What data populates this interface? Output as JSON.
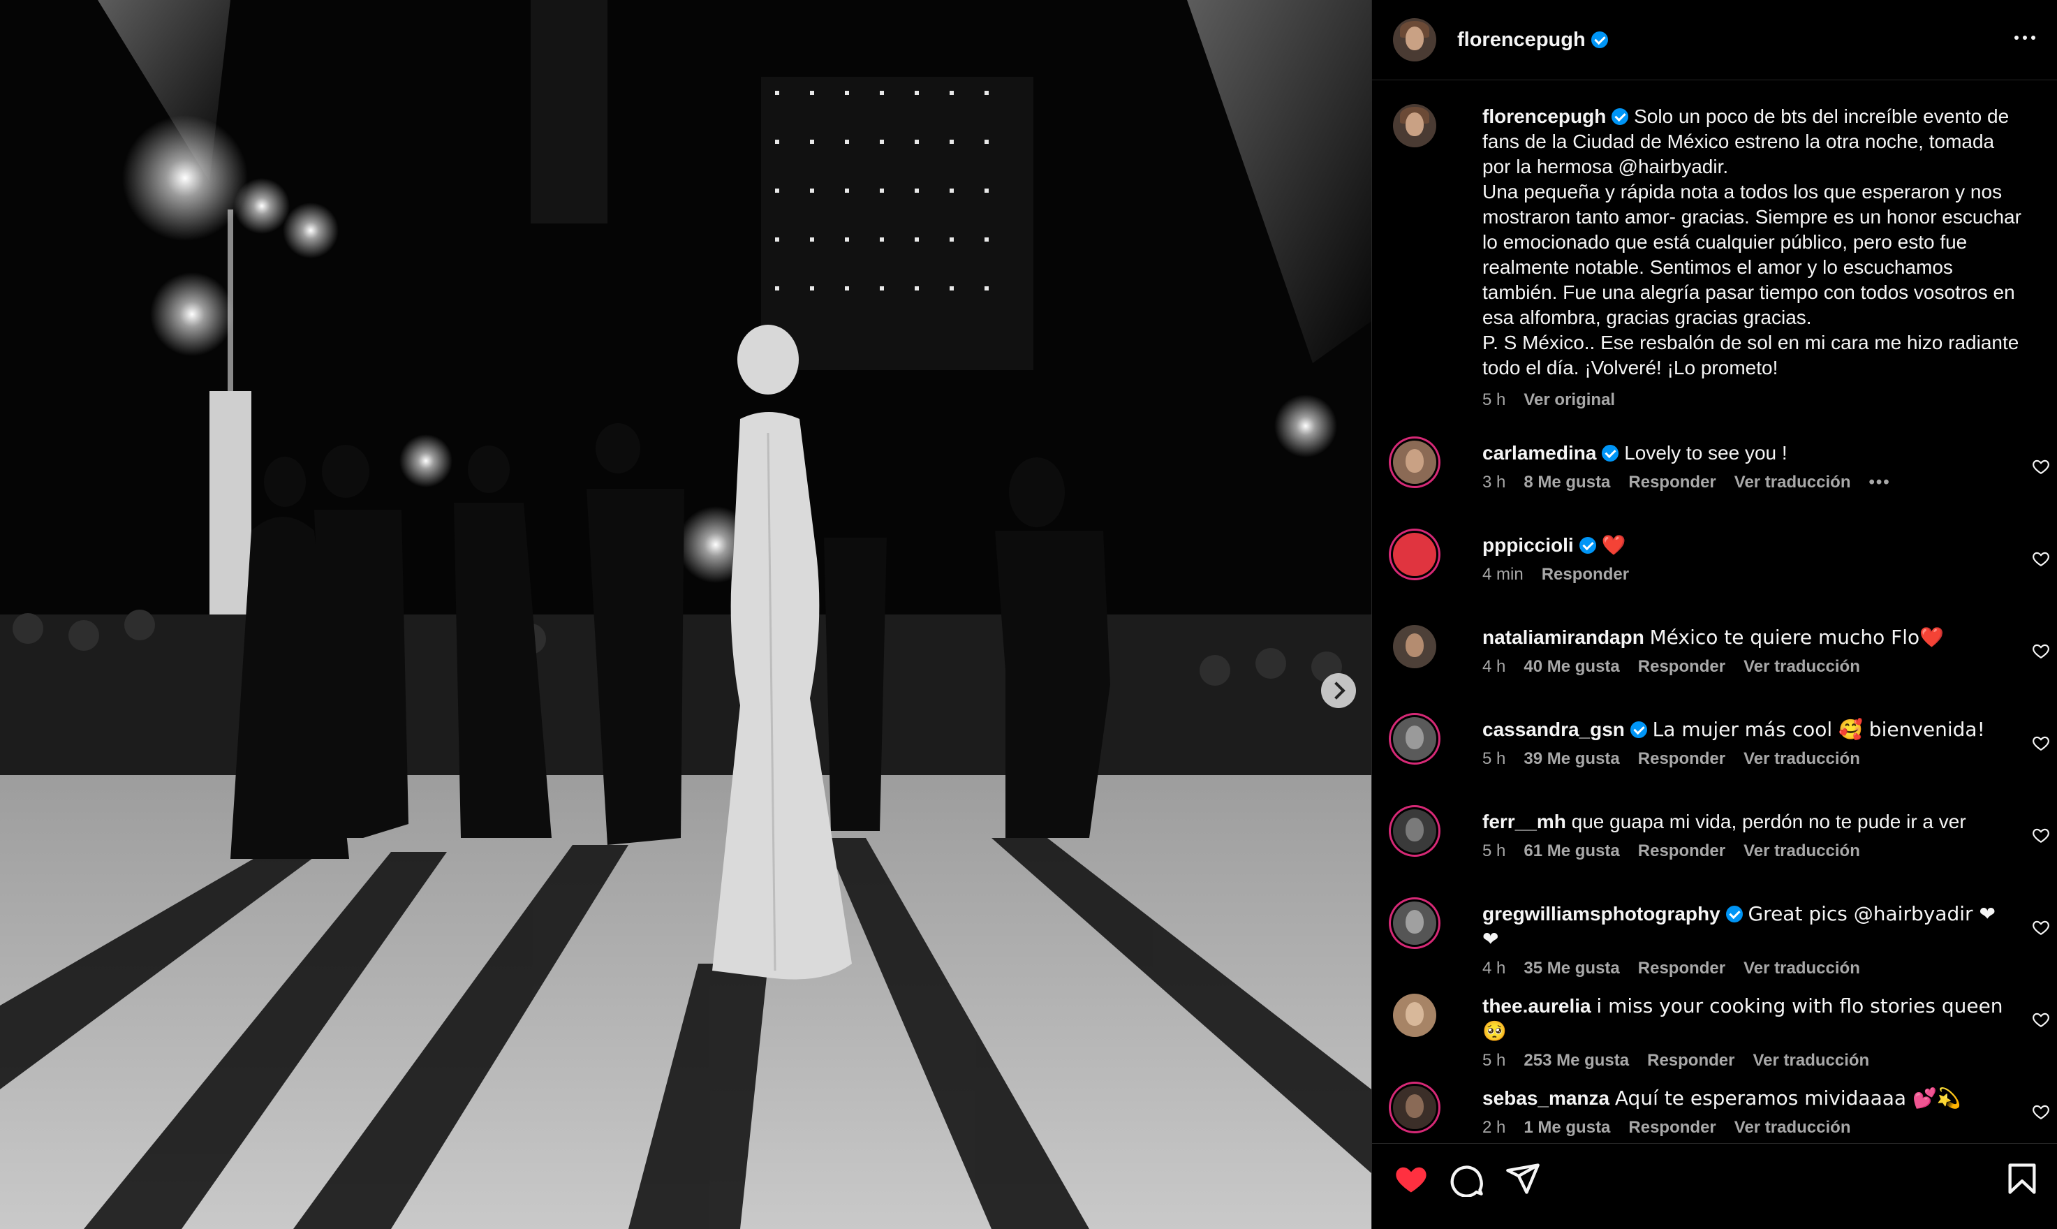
{
  "post": {
    "author": "florencepugh",
    "verified": true
  },
  "caption": {
    "author": "florencepugh",
    "lines": [
      "Solo un poco de bts del increíble evento de",
      "fans de la Ciudad de México estreno la otra noche, tomada",
      "por la hermosa @hairbyadir.",
      "Una pequeña y rápida nota a todos los que esperaron y nos",
      "mostraron tanto amor- gracias. Siempre es un honor escuchar",
      "lo emocionado que está cualquier público, pero esto fue",
      "realmente notable. Sentimos el amor y lo escuchamos",
      "también. Fue una alegría pasar tiempo con todos vosotros en",
      "esa alfombra, gracias gracias gracias.",
      "P. S México.. Ese resbalón de sol en mi cara me hizo radiante",
      "todo el día. ¡Volveré! ¡Lo prometo!"
    ],
    "time": "5 h",
    "see_original": "Ver original"
  },
  "comments": [
    {
      "user": "carlamedina",
      "verified": true,
      "text": "Lovely to see you !",
      "time": "3 h",
      "likes": "8 Me gusta",
      "reply": "Responder",
      "translate": "Ver traducción",
      "more": "•••",
      "avatar_color": "#8b6a55",
      "ring": true
    },
    {
      "user": "pppiccioli",
      "verified": true,
      "text": "❤️",
      "time": "4 min",
      "likes": "",
      "reply": "Responder",
      "translate": "",
      "more": "",
      "avatar_color": "#e0343f",
      "ring": true
    },
    {
      "user": "nataliamirandapn",
      "verified": false,
      "text": "México te quiere mucho Flo❤️",
      "time": "4 h",
      "likes": "40 Me gusta",
      "reply": "Responder",
      "translate": "Ver traducción",
      "more": "",
      "avatar_color": "#4d4038",
      "ring": false
    },
    {
      "user": "cassandra_gsn",
      "verified": true,
      "text": "La mujer más cool 🥰 bienvenida!",
      "time": "5 h",
      "likes": "39 Me gusta",
      "reply": "Responder",
      "translate": "Ver traducción",
      "more": "",
      "avatar_color": "#5a5a5a",
      "ring": true
    },
    {
      "user": "ferr__mh",
      "verified": false,
      "text": "que guapa mi vida, perdón no te pude ir a ver",
      "time": "5 h",
      "likes": "61 Me gusta",
      "reply": "Responder",
      "translate": "Ver traducción",
      "more": "",
      "avatar_color": "#3a3a3a",
      "ring": true
    },
    {
      "user": "gregwilliamsphotography",
      "verified": true,
      "text": "Great pics @hairbyadir ❤❤",
      "time": "4 h",
      "likes": "35 Me gusta",
      "reply": "Responder",
      "translate": "Ver traducción",
      "more": "",
      "avatar_color": "#555555",
      "ring": true
    },
    {
      "user": "thee.aurelia",
      "verified": false,
      "text": "i miss your cooking with flo stories queen 🥺",
      "time": "5 h",
      "likes": "253 Me gusta",
      "reply": "Responder",
      "translate": "Ver traducción",
      "more": "",
      "avatar_color": "#a78466",
      "ring": false
    },
    {
      "user": "sebas_manza",
      "verified": false,
      "text": "Aquí te esperamos mividaaaa 💕💫",
      "time": "2 h",
      "likes": "1 Me gusta",
      "reply": "Responder",
      "translate": "Ver traducción",
      "more": "",
      "avatar_color": "#3b2e28",
      "ring": true
    }
  ],
  "icons": {
    "like": "heart-filled-icon",
    "comment": "comment-icon",
    "share": "send-icon",
    "save": "bookmark-icon",
    "more": "more-options-icon",
    "next": "chevron-right-icon"
  },
  "colors": {
    "like_red": "#ff3040",
    "verified_blue": "#0095f6",
    "muted_text": "#a8a8a8"
  }
}
